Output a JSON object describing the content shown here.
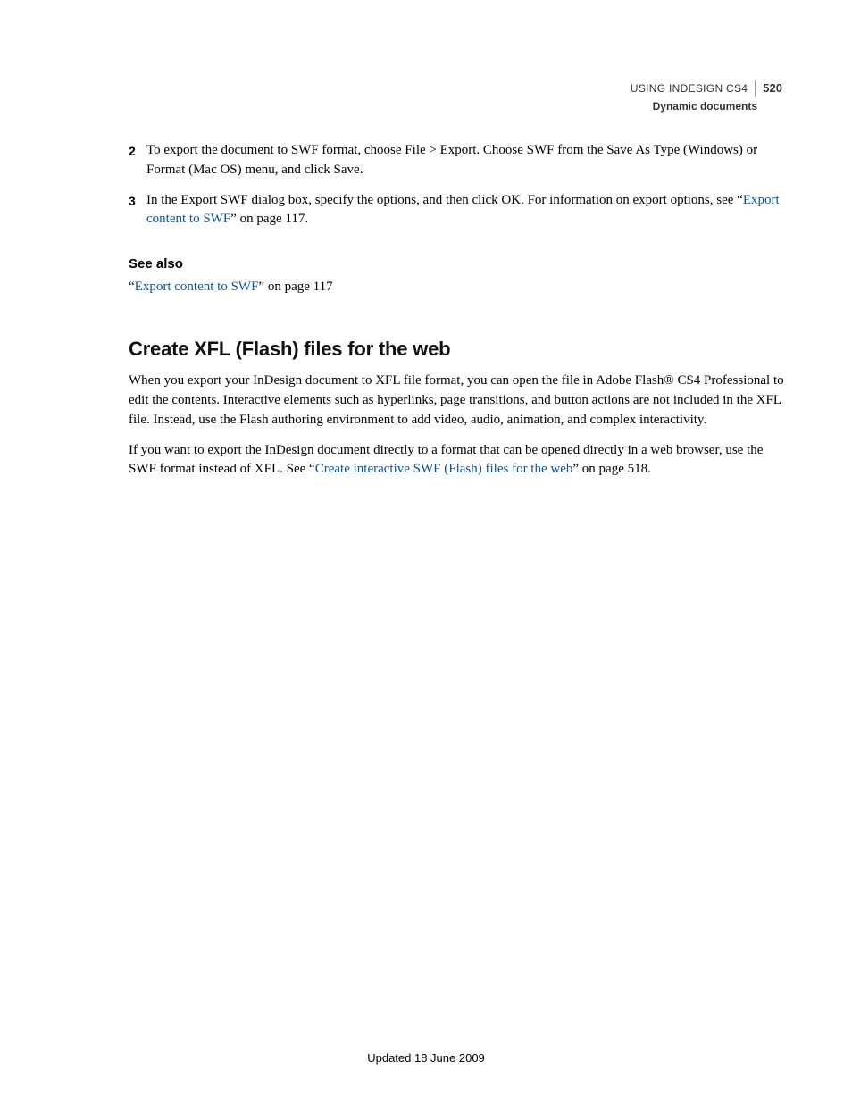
{
  "header": {
    "title": "USING INDESIGN CS4",
    "page_number": "520",
    "section": "Dynamic documents"
  },
  "steps": [
    {
      "num": "2",
      "text": "To export the document to SWF format, choose File > Export. Choose SWF from the Save As Type (Windows) or Format (Mac OS) menu, and click Save."
    },
    {
      "num": "3",
      "text_before": "In the Export SWF dialog box, specify the options, and then click OK. For information on export options, see “",
      "link": "Export content to SWF",
      "text_after": "” on page 117."
    }
  ],
  "see_also": {
    "heading": "See also",
    "prefix": "“",
    "link": "Export content to SWF",
    "suffix": "” on page 117"
  },
  "section_heading": "Create XFL (Flash) files for the web",
  "para1": "When you export your InDesign document to XFL file format, you can open the file in Adobe Flash® CS4 Professional to edit the contents. Interactive elements such as hyperlinks, page transitions, and button actions are not included in the XFL file. Instead, use the Flash authoring environment to add video, audio, animation, and complex interactivity.",
  "para2": {
    "before": "If you want to export the InDesign document directly to a format that can be opened directly in a web browser, use the SWF format instead of XFL. See “",
    "link": "Create interactive SWF (Flash) files for the web",
    "after": "” on page 518."
  },
  "footer": "Updated 18 June 2009"
}
